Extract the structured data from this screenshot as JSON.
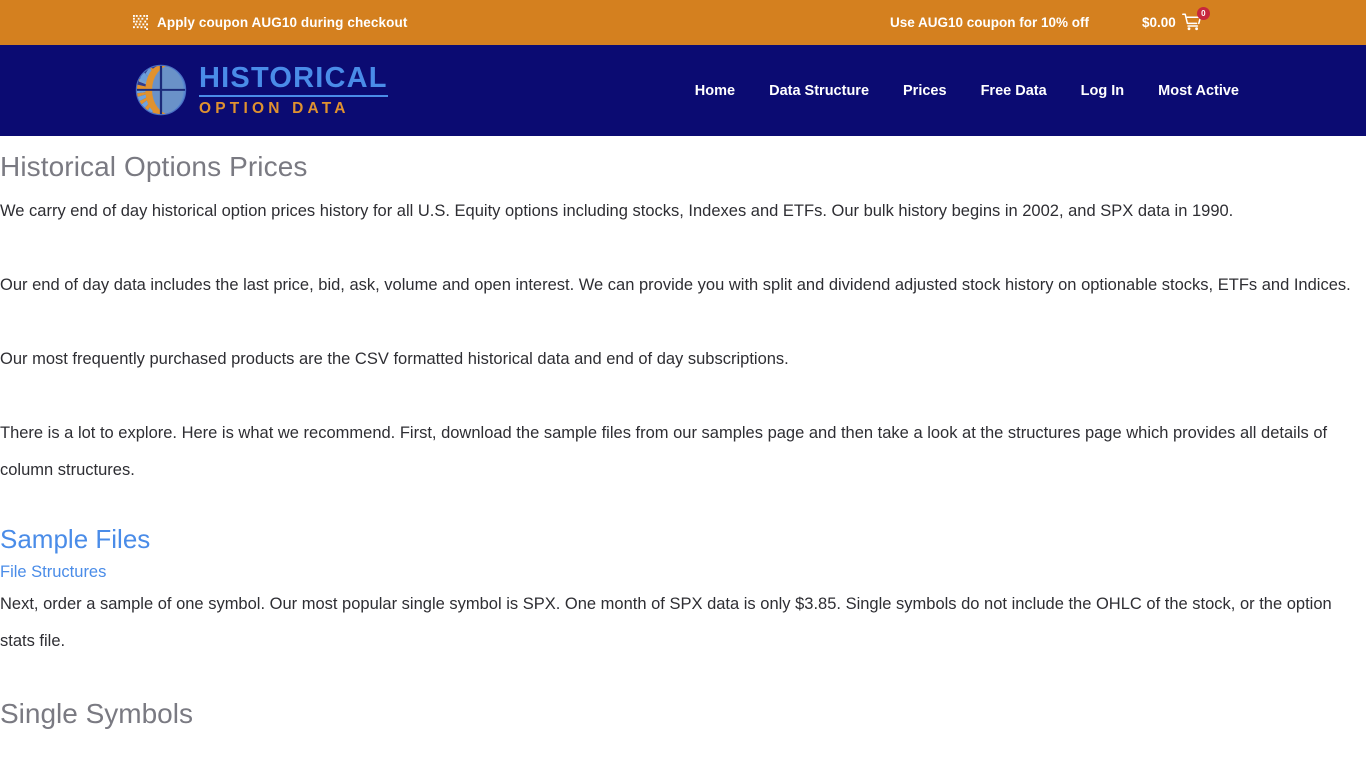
{
  "promo_bar": {
    "coupon_icon": "qr-code-icon",
    "coupon_text": "Apply coupon AUG10 during checkout",
    "offer_text": "Use AUG10 coupon for 10% off",
    "cart_total": "$0.00",
    "cart_icon": "shopping-cart-icon",
    "cart_count": "0",
    "bar_color": "#d4801f",
    "badge_color": "#c7273d"
  },
  "header": {
    "logo": {
      "icon": "globe-rays-logo-icon",
      "line1": "HISTORICAL",
      "line2": "OPTION DATA",
      "line1_color": "#4a8ce8",
      "line2_color": "#e0922f"
    },
    "background_color": "#0b0b72",
    "nav": [
      {
        "label": "Home"
      },
      {
        "label": "Data Structure"
      },
      {
        "label": "Prices"
      },
      {
        "label": "Free Data"
      },
      {
        "label": "Log In"
      },
      {
        "label": "Most Active"
      }
    ]
  },
  "main": {
    "title": "Historical Options Prices",
    "title_color": "#7a7a82",
    "paragraphs": [
      "We carry end of day historical option prices history for all U.S. Equity options including stocks, Indexes and ETFs. Our bulk history begins in 2002, and SPX data in 1990.",
      "Our end of day data includes the last price, bid, ask, volume and open interest. We can provide you with split and dividend adjusted stock history on optionable stocks, ETFs and Indices.",
      "Our most frequently purchased products are the CSV formatted historical data and end of day subscriptions.",
      "There is a lot to explore. Here is what we recommend. First, download the sample files from our samples page and then take a look at the structures page which provides all details of column structures."
    ],
    "sample_files_link": "Sample Files",
    "file_structures_link": "File Structures",
    "link_color": "#4a8ce8",
    "next_paragraph": "Next, order a sample of one symbol. Our most popular single symbol is SPX. One month of SPX data is only $3.85. Single symbols do not include the OHLC of the stock, or the option stats file.",
    "cut_off_heading": "Single Symbols"
  }
}
